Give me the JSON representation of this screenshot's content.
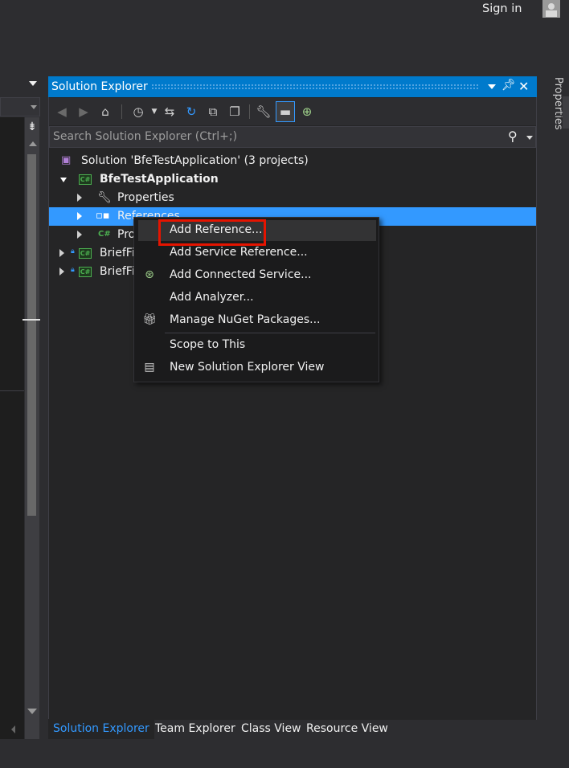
{
  "topbar": {
    "sign_in": "Sign in"
  },
  "solution_explorer": {
    "title": "Solution Explorer",
    "search_placeholder": "Search Solution Explorer (Ctrl+;)",
    "tree": {
      "solution": "Solution 'BfeTestApplication' (3 projects)",
      "project": "BfeTestApplication",
      "properties": "Properties",
      "references": "References",
      "program": "Pro",
      "briefing1": "BriefFi",
      "briefing2": "BriefFi"
    },
    "context_menu": {
      "add_reference": "Add Reference...",
      "add_service_reference": "Add Service Reference...",
      "add_connected_service": "Add Connected Service...",
      "add_analyzer": "Add Analyzer...",
      "manage_nuget": "Manage NuGet Packages...",
      "scope_to_this": "Scope to This",
      "new_se_view": "New Solution Explorer View"
    }
  },
  "bottom_tabs": {
    "solution_explorer": "Solution Explorer",
    "team_explorer": "Team Explorer",
    "class_view": "Class View",
    "resource_view": "Resource View"
  },
  "right_tab": {
    "properties": "Properties"
  },
  "icons": {
    "back": "back-arrow-icon",
    "forward": "forward-arrow-icon",
    "home": "home-icon",
    "history": "history-icon",
    "sync": "sync-icon",
    "refresh": "refresh-icon",
    "collapse": "collapse-all-icon",
    "show_all": "show-all-files-icon",
    "properties": "wrench-icon",
    "preview": "preview-icon",
    "diagram": "class-diagram-icon"
  },
  "colors": {
    "accent": "#007acc",
    "selection": "#3399ff",
    "highlight_box": "#e51400"
  }
}
